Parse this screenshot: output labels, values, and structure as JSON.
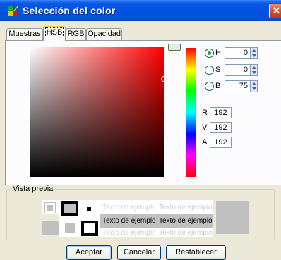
{
  "window": {
    "title": "Selección del color",
    "close_symbol": "✕"
  },
  "tabs": [
    {
      "label": "Muestras",
      "active": false
    },
    {
      "label": "HSB",
      "active": true
    },
    {
      "label": "RGB",
      "active": false
    },
    {
      "label": "Opacidad",
      "active": false
    }
  ],
  "hsb": {
    "selected_mode": "H",
    "h": {
      "label": "H",
      "value": "0"
    },
    "s": {
      "label": "S",
      "value": "0"
    },
    "b": {
      "label": "B",
      "value": "75"
    }
  },
  "rgb_readout": {
    "r": {
      "label": "R",
      "value": "192"
    },
    "v": {
      "label": "V",
      "value": "192"
    },
    "a": {
      "label": "A",
      "value": "192"
    }
  },
  "preview": {
    "legend": "Vista previa",
    "sample_text": "Texto de ejemplo",
    "color": "#c0c0c0"
  },
  "buttons": {
    "accept": "Aceptar",
    "cancel": "Cancelar",
    "reset": "Restablecer"
  }
}
